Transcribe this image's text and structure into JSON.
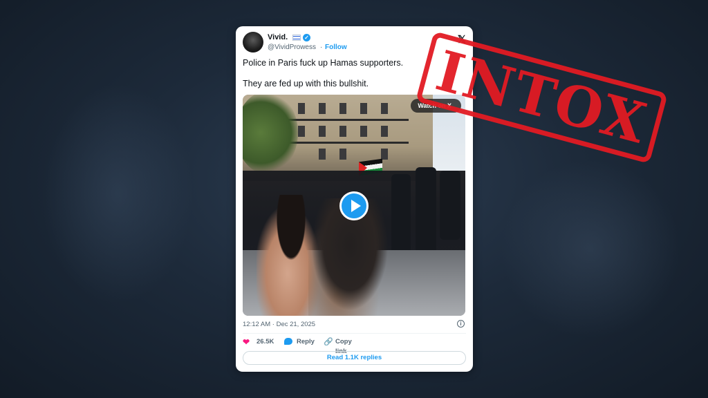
{
  "tweet": {
    "display_name": "Vivid.",
    "handle": "@VividProwess",
    "separator": "·",
    "follow_label": "Follow",
    "x_logo": "𝕏",
    "verified_glyph": "✓",
    "text_line1": "Police in Paris fuck up Hamas supporters.",
    "text_line2": "They are fed up with this bullshit.",
    "video": {
      "watch_label": "Watch on X"
    },
    "timestamp": "12:12 AM · Dec 21, 2025",
    "info_glyph": "i",
    "likes": "26.5K",
    "reply_label": "Reply",
    "copy_link_label": "Copy link",
    "read_replies_label": "Read 1.1K replies"
  },
  "stamp": {
    "text": "INTOX",
    "color": "#e21b23"
  },
  "colors": {
    "accent": "#1d9bf0",
    "like": "#f91880"
  },
  "icons": [
    "avatar",
    "israel-flag-icon",
    "verified-icon",
    "x-logo-icon",
    "play-icon",
    "info-icon",
    "heart-icon",
    "reply-icon",
    "link-icon"
  ]
}
